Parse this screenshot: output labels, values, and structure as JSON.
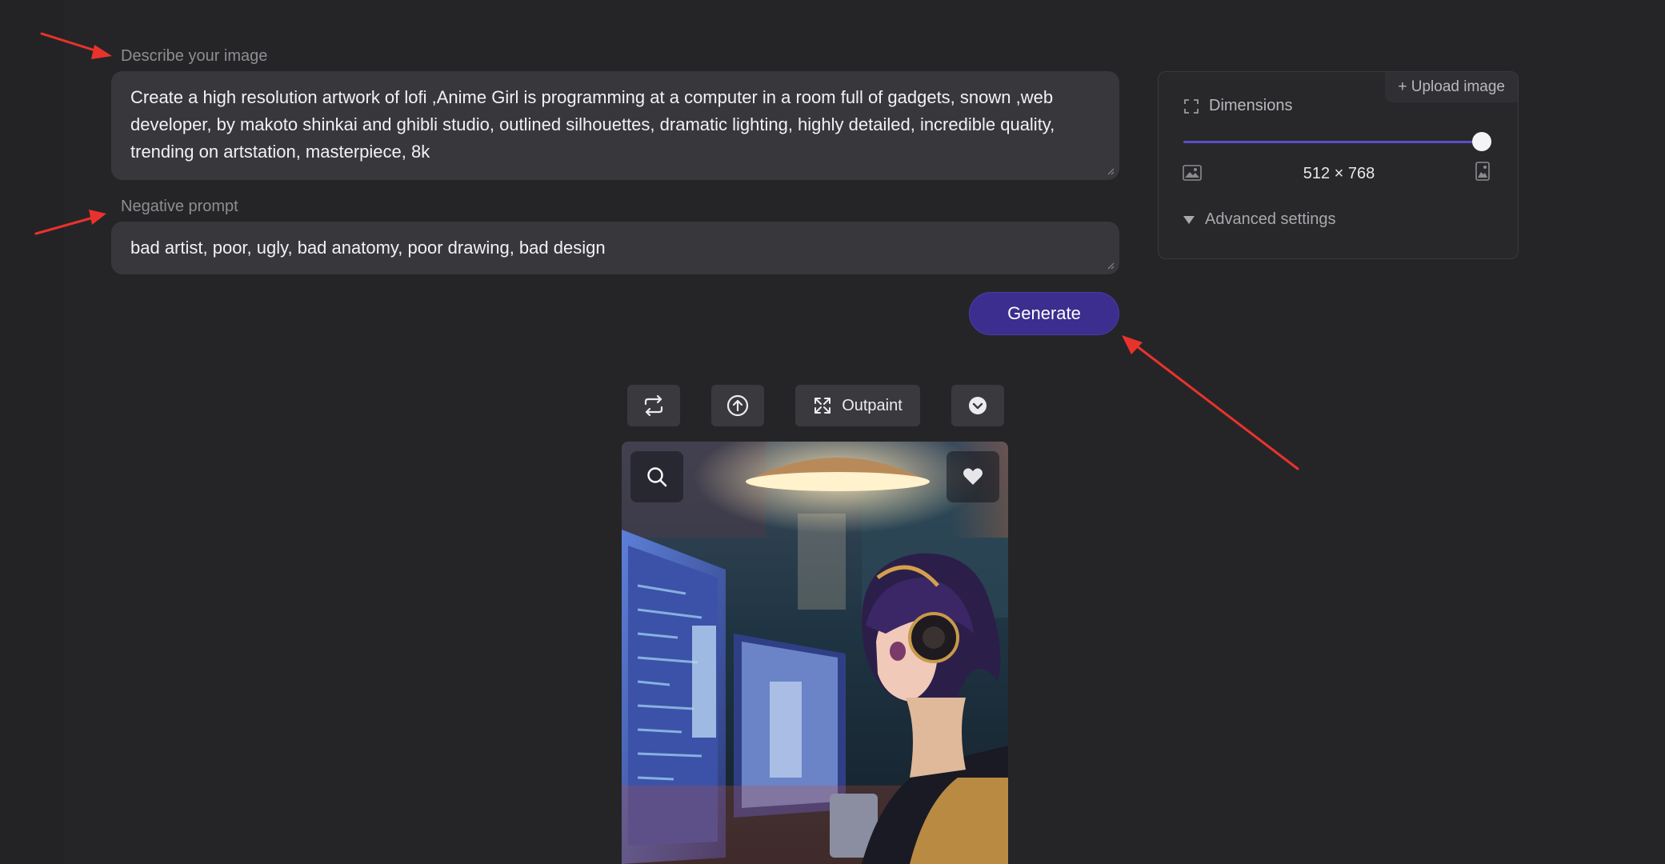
{
  "form": {
    "describe_label": "Describe your image",
    "prompt_text": "Create a high resolution artwork of lofi ,Anime Girl is programming at a computer in a room full of gadgets, snown ,web developer, by makoto shinkai and ghibli studio, outlined silhouettes, dramatic lighting, highly detailed, incredible quality, trending on artstation, masterpiece, 8k",
    "negative_label": "Negative prompt",
    "negative_text": "bad artist, poor, ugly, bad anatomy, poor drawing, bad design",
    "generate_label": "Generate"
  },
  "settings": {
    "upload_label": "+ Upload image",
    "dimensions_label": "Dimensions",
    "dimensions_value": "512 × 768",
    "slider_level": 1.0,
    "advanced_label": "Advanced settings"
  },
  "toolbar": {
    "outpaint_label": "Outpaint"
  },
  "colors": {
    "background": "#252528",
    "accent": "#3b2e8f",
    "slider_fill": "#5a4fc8",
    "annotation_arrow": "#e8332c"
  }
}
